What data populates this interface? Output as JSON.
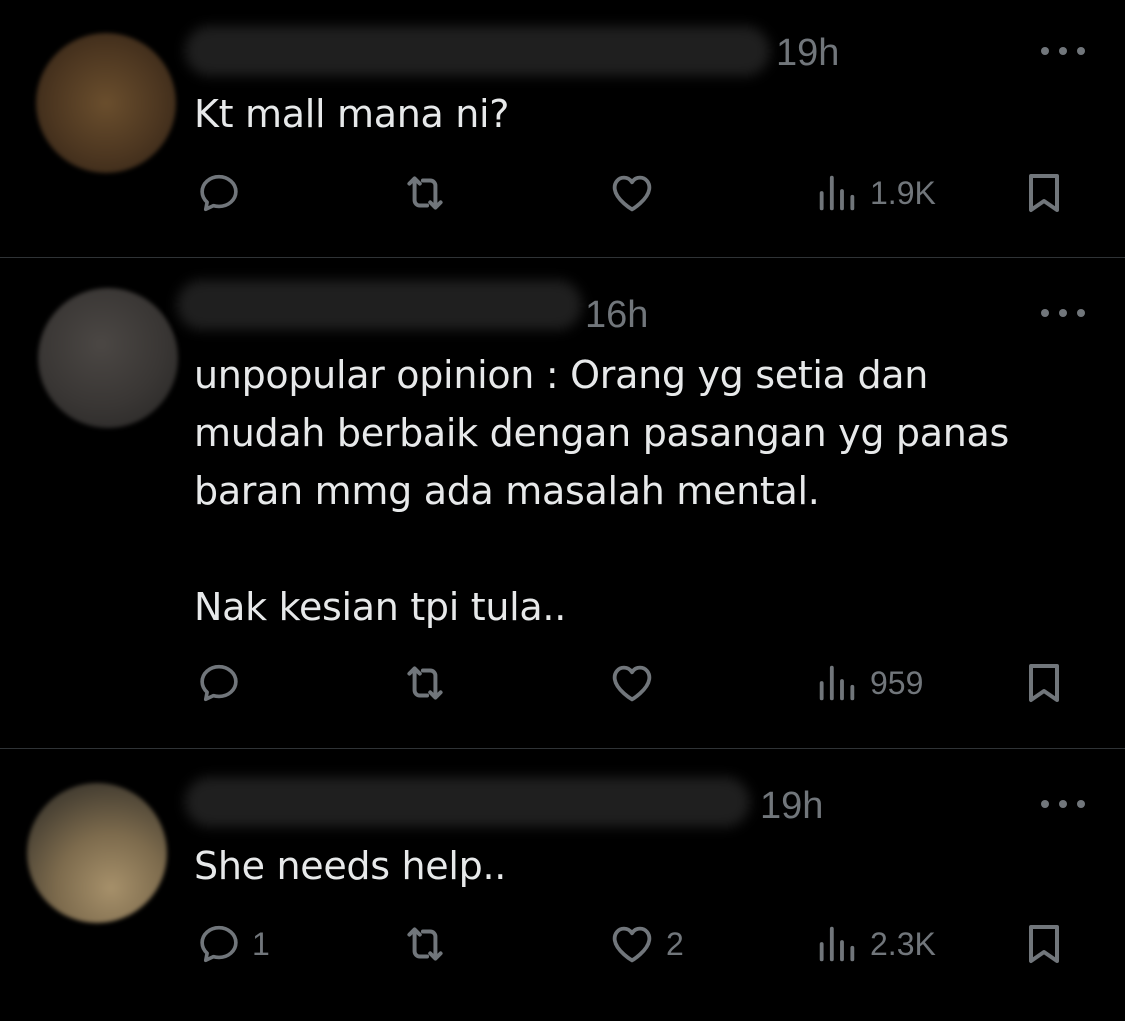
{
  "colors": {
    "background": "#000000",
    "text": "#e7e9ea",
    "muted": "#71767b",
    "divider": "#2f3336"
  },
  "tweets": [
    {
      "time": "19h",
      "text": "Kt mall mana ni?",
      "replies": "",
      "likes": "",
      "views": "1.9K"
    },
    {
      "time": "16h",
      "text": "unpopular opinion : Orang yg setia dan\nmudah berbaik dengan pasangan yg panas\nbaran mmg ada masalah mental.\n\nNak kesian tpi tula..",
      "replies": "",
      "likes": "",
      "views": "959"
    },
    {
      "time": "19h",
      "text": "She needs help..",
      "replies": "1",
      "likes": "2",
      "views": "2.3K"
    }
  ],
  "icons": {
    "reply": "reply-icon",
    "retweet": "retweet-icon",
    "like": "heart-icon",
    "views": "views-icon",
    "bookmark": "bookmark-icon",
    "more": "more-icon"
  }
}
